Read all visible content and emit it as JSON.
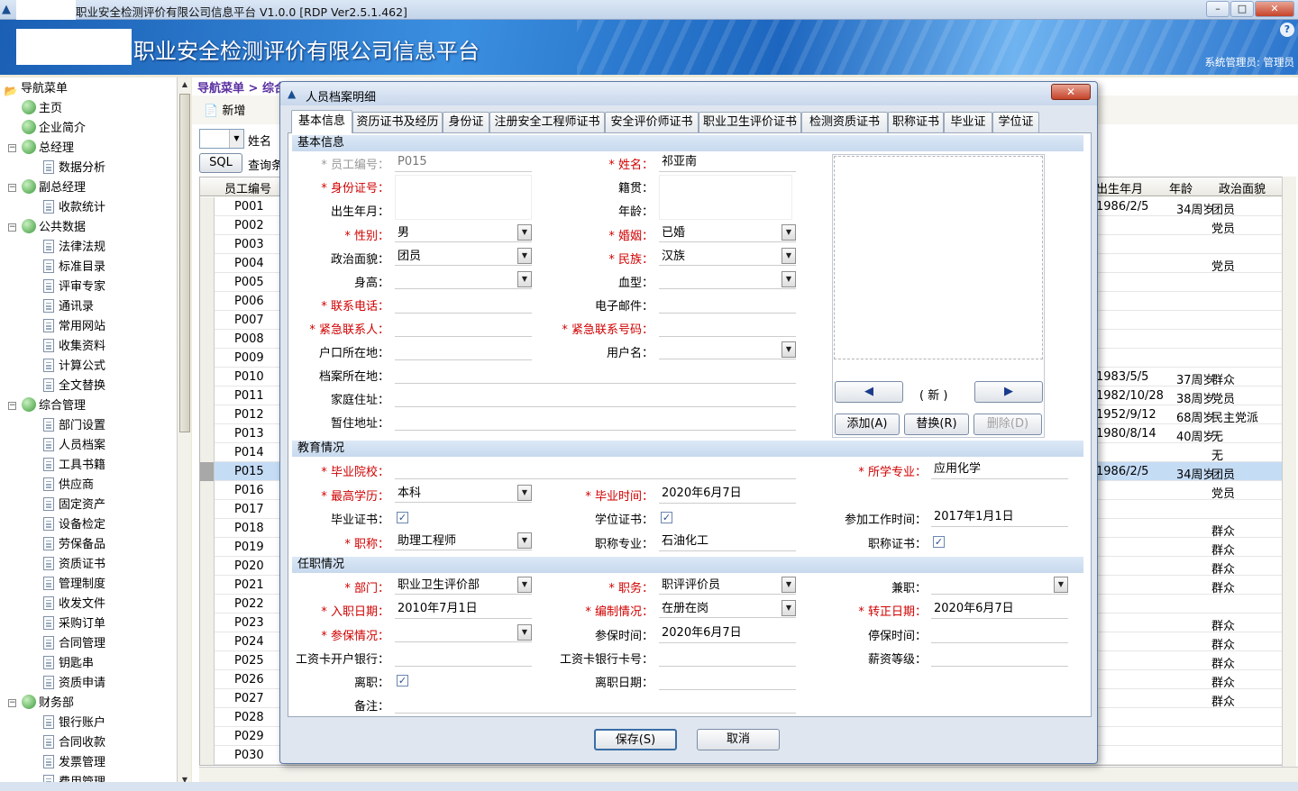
{
  "window": {
    "title": "职业安全检测评价有限公司信息平台 V1.0.0 [RDP Ver2.5.1.462]",
    "min": "–",
    "max": "□",
    "close": "✕"
  },
  "banner": {
    "title": "职业安全检测评价有限公司信息平台",
    "user": "系统管理员: 管理员",
    "help": "?"
  },
  "nav": {
    "root": "导航菜单",
    "items": [
      {
        "label": "主页",
        "level": 1,
        "icon": "globe"
      },
      {
        "label": "企业简介",
        "level": 1,
        "icon": "globe"
      },
      {
        "label": "总经理",
        "level": 0,
        "icon": "globe"
      },
      {
        "label": "数据分析",
        "level": 2,
        "icon": "doc"
      },
      {
        "label": "副总经理",
        "level": 0,
        "icon": "globe"
      },
      {
        "label": "收款统计",
        "level": 2,
        "icon": "doc"
      },
      {
        "label": "公共数据",
        "level": 0,
        "icon": "globe"
      },
      {
        "label": "法律法规",
        "level": 2,
        "icon": "doc"
      },
      {
        "label": "标准目录",
        "level": 2,
        "icon": "doc"
      },
      {
        "label": "评审专家",
        "level": 2,
        "icon": "doc"
      },
      {
        "label": "通讯录",
        "level": 2,
        "icon": "doc"
      },
      {
        "label": "常用网站",
        "level": 2,
        "icon": "doc"
      },
      {
        "label": "收集资料",
        "level": 2,
        "icon": "doc"
      },
      {
        "label": "计算公式",
        "level": 2,
        "icon": "doc"
      },
      {
        "label": "全文替换",
        "level": 2,
        "icon": "doc"
      },
      {
        "label": "综合管理",
        "level": 0,
        "icon": "globe"
      },
      {
        "label": "部门设置",
        "level": 2,
        "icon": "doc"
      },
      {
        "label": "人员档案",
        "level": 2,
        "icon": "doc"
      },
      {
        "label": "工具书籍",
        "level": 2,
        "icon": "doc"
      },
      {
        "label": "供应商",
        "level": 2,
        "icon": "doc"
      },
      {
        "label": "固定资产",
        "level": 2,
        "icon": "doc"
      },
      {
        "label": "设备检定",
        "level": 2,
        "icon": "doc"
      },
      {
        "label": "劳保备品",
        "level": 2,
        "icon": "doc"
      },
      {
        "label": "资质证书",
        "level": 2,
        "icon": "doc"
      },
      {
        "label": "管理制度",
        "level": 2,
        "icon": "doc"
      },
      {
        "label": "收发文件",
        "level": 2,
        "icon": "doc"
      },
      {
        "label": "采购订单",
        "level": 2,
        "icon": "doc"
      },
      {
        "label": "合同管理",
        "level": 2,
        "icon": "doc"
      },
      {
        "label": "钥匙串",
        "level": 2,
        "icon": "doc"
      },
      {
        "label": "资质申请",
        "level": 2,
        "icon": "doc"
      },
      {
        "label": "财务部",
        "level": 0,
        "icon": "globe"
      },
      {
        "label": "银行账户",
        "level": 2,
        "icon": "doc"
      },
      {
        "label": "合同收款",
        "level": 2,
        "icon": "doc"
      },
      {
        "label": "发票管理",
        "level": 2,
        "icon": "doc"
      },
      {
        "label": "费用管理",
        "level": 2,
        "icon": "doc"
      }
    ]
  },
  "background": {
    "breadcrumb": "导航菜单 > 综合管理 > 人员档案",
    "new_label": "新增",
    "filter_field": "姓名",
    "sql_label": "SQL",
    "query_label": "查询条",
    "columns": [
      "员工编号",
      "出生年月",
      "年龄",
      "政治面貌"
    ],
    "rows": [
      {
        "id": "P001",
        "birth": "1986/2/5",
        "age": "34周岁",
        "party": "团员"
      },
      {
        "id": "P002",
        "birth": "",
        "age": "",
        "party": "党员"
      },
      {
        "id": "P003",
        "birth": "",
        "age": "",
        "party": ""
      },
      {
        "id": "P004",
        "birth": "",
        "age": "",
        "party": "党员"
      },
      {
        "id": "P005",
        "birth": "",
        "age": "",
        "party": ""
      },
      {
        "id": "P006",
        "birth": "",
        "age": "",
        "party": ""
      },
      {
        "id": "P007",
        "birth": "",
        "age": "",
        "party": ""
      },
      {
        "id": "P008",
        "birth": "",
        "age": "",
        "party": ""
      },
      {
        "id": "P009",
        "birth": "",
        "age": "",
        "party": ""
      },
      {
        "id": "P010",
        "birth": "1983/5/5",
        "age": "37周岁",
        "party": "群众"
      },
      {
        "id": "P011",
        "birth": "1982/10/28",
        "age": "38周岁",
        "party": "党员"
      },
      {
        "id": "P012",
        "birth": "1952/9/12",
        "age": "68周岁",
        "party": "民主党派"
      },
      {
        "id": "P013",
        "birth": "1980/8/14",
        "age": "40周岁",
        "party": "无"
      },
      {
        "id": "P014",
        "birth": "",
        "age": "",
        "party": "无"
      },
      {
        "id": "P015",
        "birth": "1986/2/5",
        "age": "34周岁",
        "party": "团员"
      },
      {
        "id": "P016",
        "birth": "",
        "age": "",
        "party": "党员"
      },
      {
        "id": "P017",
        "birth": "",
        "age": "",
        "party": ""
      },
      {
        "id": "P018",
        "birth": "",
        "age": "",
        "party": "群众"
      },
      {
        "id": "P019",
        "birth": "",
        "age": "",
        "party": "群众"
      },
      {
        "id": "P020",
        "birth": "",
        "age": "",
        "party": "群众"
      },
      {
        "id": "P021",
        "birth": "",
        "age": "",
        "party": "群众"
      },
      {
        "id": "P022",
        "birth": "",
        "age": "",
        "party": ""
      },
      {
        "id": "P023",
        "birth": "",
        "age": "",
        "party": "群众"
      },
      {
        "id": "P024",
        "birth": "",
        "age": "",
        "party": "群众"
      },
      {
        "id": "P025",
        "birth": "",
        "age": "",
        "party": "群众"
      },
      {
        "id": "P026",
        "birth": "",
        "age": "",
        "party": "群众"
      },
      {
        "id": "P027",
        "birth": "",
        "age": "",
        "party": "群众"
      },
      {
        "id": "P028",
        "birth": "",
        "age": "",
        "party": ""
      },
      {
        "id": "P029",
        "birth": "",
        "age": "",
        "party": ""
      },
      {
        "id": "P030",
        "birth": "",
        "age": "",
        "party": ""
      }
    ],
    "selected_row": "P015"
  },
  "dialog": {
    "title": "人员档案明细",
    "close": "✕",
    "tabs": [
      "基本信息",
      "资历证书及经历",
      "身份证",
      "注册安全工程师证书",
      "安全评价师证书",
      "职业卫生评价证书",
      "检测资质证书",
      "职称证书",
      "毕业证",
      "学位证"
    ],
    "active_tab": "基本信息",
    "sections": {
      "basic": "基本信息",
      "education": "教育情况",
      "employment": "任职情况"
    },
    "fields": {
      "emp_no_label": "员工编号：",
      "emp_no": "P015",
      "name_label": "姓名：",
      "name": "祁亚南",
      "id_label": "身份证号：",
      "native_label": "籍贯：",
      "birth_label": "出生年月：",
      "age_label": "年龄：",
      "gender_label": "性别：",
      "gender": "男",
      "marriage_label": "婚姻：",
      "marriage": "已婚",
      "political_label": "政治面貌：",
      "political": "团员",
      "ethnic_label": "民族：",
      "ethnic": "汉族",
      "height_label": "身高：",
      "blood_label": "血型：",
      "phone_label": "联系电话：",
      "email_label": "电子邮件：",
      "emergency_label": "紧急联系人：",
      "emergency_phone_label": "紧急联系号码：",
      "hukou_label": "户口所在地：",
      "username_label": "用户名：",
      "archive_label": "档案所在地：",
      "home_label": "家庭住址：",
      "temp_label": "暂住地址：",
      "school_label": "毕业院校：",
      "major_label": "所学专业：",
      "major": "应用化学",
      "degree_label": "最高学历：",
      "degree": "本科",
      "grad_time_label": "毕业时间：",
      "grad_time": "2020年6月7日",
      "grad_cert_label": "毕业证书：",
      "degree_cert_label": "学位证书：",
      "work_start_label": "参加工作时间：",
      "work_start": "2017年1月1日",
      "title_label": "职称：",
      "title": "助理工程师",
      "title_major_label": "职称专业：",
      "title_major": "石油化工",
      "title_cert_label": "职称证书：",
      "dept_label": "部门：",
      "dept": "职业卫生评价部",
      "post_label": "职务：",
      "post": "职评评价员",
      "parttime_label": "兼职：",
      "hire_label": "入职日期：",
      "hire": "2010年7月1日",
      "staffing_label": "编制情况：",
      "staffing": "在册在岗",
      "regular_label": "转正日期：",
      "regular": "2020年6月7日",
      "insure_label": "参保情况：",
      "insure_time_label": "参保时间：",
      "insure_time": "2020年6月7日",
      "stop_insure_label": "停保时间：",
      "bank_label": "工资卡开户银行：",
      "card_label": "工资卡银行卡号：",
      "salary_label": "薪资等级：",
      "resign_label": "离职：",
      "resign_date_label": "离职日期：",
      "remark_label": "备注："
    },
    "photo": {
      "prev": "◀",
      "next": "▶",
      "status": "( 新 )",
      "add": "添加(A)",
      "replace": "替换(R)",
      "delete": "删除(D)"
    },
    "save": "保存(S)",
    "cancel": "取消"
  }
}
